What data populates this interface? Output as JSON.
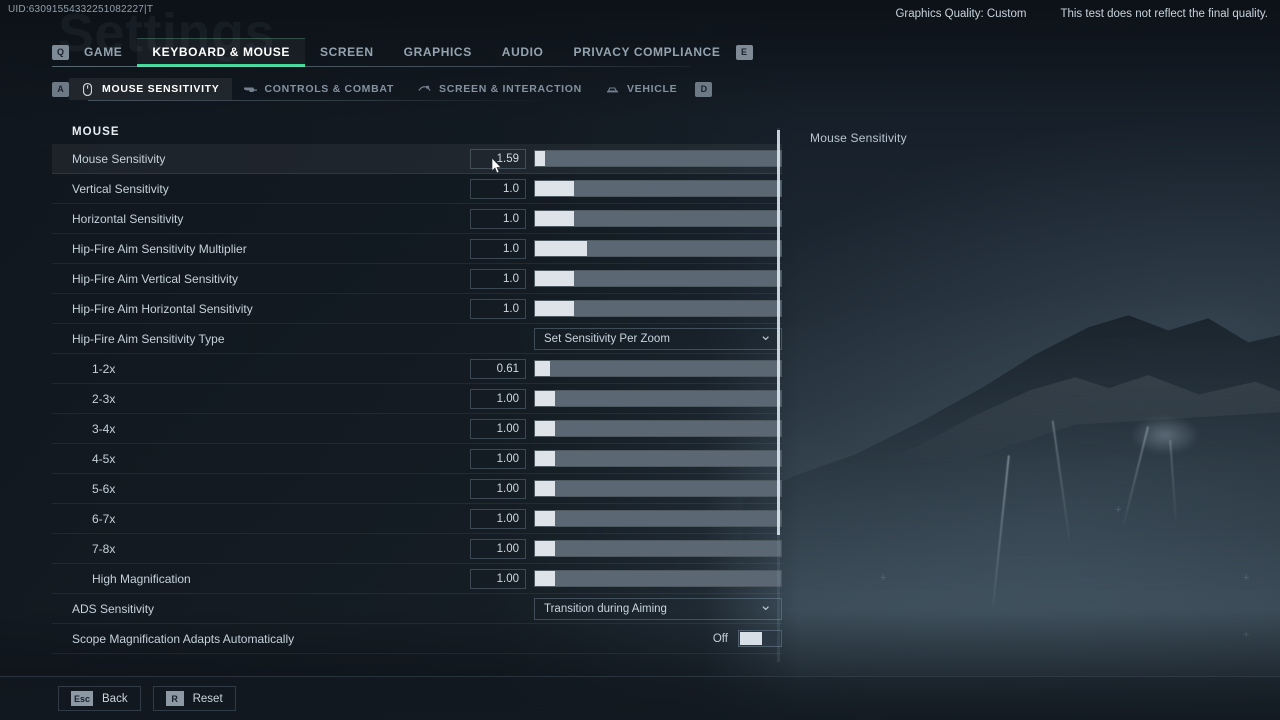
{
  "uid": "UID:63091554332251082227|T",
  "watermark": "Settings",
  "topright": {
    "graphics_quality": "Graphics Quality: Custom",
    "disclaimer": "This test does not reflect the final quality."
  },
  "tabs": {
    "prev_key": "Q",
    "next_key": "E",
    "items": [
      {
        "label": "GAME",
        "active": false
      },
      {
        "label": "KEYBOARD & MOUSE",
        "active": true
      },
      {
        "label": "SCREEN",
        "active": false
      },
      {
        "label": "GRAPHICS",
        "active": false
      },
      {
        "label": "AUDIO",
        "active": false
      },
      {
        "label": "PRIVACY COMPLIANCE",
        "active": false
      }
    ]
  },
  "subtabs": {
    "prev_key": "A",
    "next_key": "D",
    "items": [
      {
        "label": "MOUSE SENSITIVITY",
        "icon": "mouse-icon",
        "active": true
      },
      {
        "label": "CONTROLS & COMBAT",
        "icon": "weapon-icon",
        "active": false
      },
      {
        "label": "SCREEN & INTERACTION",
        "icon": "crosshair-icon",
        "active": false
      },
      {
        "label": "VEHICLE",
        "icon": "vehicle-icon",
        "active": false
      }
    ]
  },
  "panel": {
    "section": "MOUSE",
    "rows": [
      {
        "label": "Mouse Sensitivity",
        "type": "slider",
        "value": "1.59",
        "fill": 4,
        "selected": true,
        "sub": false
      },
      {
        "label": "Vertical Sensitivity",
        "type": "slider",
        "value": "1.0",
        "fill": 16,
        "selected": false,
        "sub": false
      },
      {
        "label": "Horizontal Sensitivity",
        "type": "slider",
        "value": "1.0",
        "fill": 16,
        "selected": false,
        "sub": false
      },
      {
        "label": "Hip-Fire Aim Sensitivity Multiplier",
        "type": "slider",
        "value": "1.0",
        "fill": 21,
        "selected": false,
        "sub": false
      },
      {
        "label": "Hip-Fire Aim Vertical Sensitivity",
        "type": "slider",
        "value": "1.0",
        "fill": 16,
        "selected": false,
        "sub": false
      },
      {
        "label": "Hip-Fire Aim Horizontal Sensitivity",
        "type": "slider",
        "value": "1.0",
        "fill": 16,
        "selected": false,
        "sub": false
      },
      {
        "label": "Hip-Fire Aim Sensitivity Type",
        "type": "dropdown",
        "value": "Set Sensitivity Per Zoom",
        "selected": false,
        "sub": false
      },
      {
        "label": "1-2x",
        "type": "slider",
        "value": "0.61",
        "fill": 6,
        "selected": false,
        "sub": true
      },
      {
        "label": "2-3x",
        "type": "slider",
        "value": "1.00",
        "fill": 8,
        "selected": false,
        "sub": true
      },
      {
        "label": "3-4x",
        "type": "slider",
        "value": "1.00",
        "fill": 8,
        "selected": false,
        "sub": true
      },
      {
        "label": "4-5x",
        "type": "slider",
        "value": "1.00",
        "fill": 8,
        "selected": false,
        "sub": true
      },
      {
        "label": "5-6x",
        "type": "slider",
        "value": "1.00",
        "fill": 8,
        "selected": false,
        "sub": true
      },
      {
        "label": "6-7x",
        "type": "slider",
        "value": "1.00",
        "fill": 8,
        "selected": false,
        "sub": true
      },
      {
        "label": "7-8x",
        "type": "slider",
        "value": "1.00",
        "fill": 8,
        "selected": false,
        "sub": true
      },
      {
        "label": "High Magnification",
        "type": "slider",
        "value": "1.00",
        "fill": 8,
        "selected": false,
        "sub": true
      },
      {
        "label": "ADS Sensitivity",
        "type": "dropdown",
        "value": "Transition during Aiming",
        "selected": false,
        "sub": false
      },
      {
        "label": "Scope Magnification Adapts Automatically",
        "type": "toggle",
        "value": "Off",
        "selected": false,
        "sub": false
      }
    ]
  },
  "description": {
    "title": "Mouse Sensitivity"
  },
  "bottombar": {
    "back": {
      "key": "Esc",
      "label": "Back"
    },
    "reset": {
      "key": "R",
      "label": "Reset"
    }
  },
  "colors": {
    "accent": "#3ddc97",
    "slider_fill": "#dde3e9",
    "slider_track": "#5b6873"
  }
}
